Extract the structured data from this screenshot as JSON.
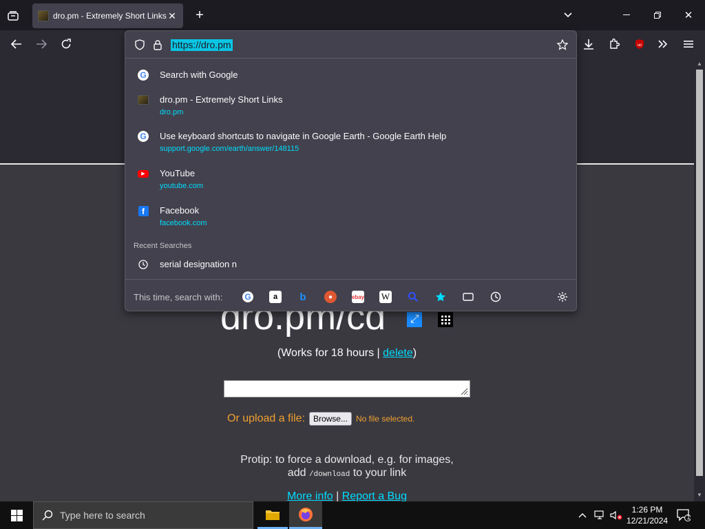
{
  "browser": {
    "tab_title": "dro.pm - Extremely Short Links",
    "url": "https://dro.pm"
  },
  "suggestions": [
    {
      "title": "Search with Google",
      "url": "",
      "icon": "google-icon"
    },
    {
      "title": "dro.pm - Extremely Short Links",
      "url": "dro.pm",
      "icon": "site-favicon"
    },
    {
      "title": "Use keyboard shortcuts to navigate in Google Earth - Google Earth Help",
      "url": "support.google.com/earth/answer/148115",
      "icon": "google-icon"
    },
    {
      "title": "YouTube",
      "url": "youtube.com",
      "icon": "youtube-icon"
    },
    {
      "title": "Facebook",
      "url": "facebook.com",
      "icon": "facebook-icon"
    }
  ],
  "recent": {
    "label": "Recent Searches",
    "items": [
      "serial designation n"
    ]
  },
  "search_with": {
    "label": "This time, search with:"
  },
  "page": {
    "short_url": "dro.pm/cd",
    "works_prefix": "(Works for 18 hours | ",
    "delete": "delete",
    "works_suffix": ")",
    "upload_label": "Or upload a file:",
    "browse": "Browse...",
    "no_file": "No file selected.",
    "protip_line1": "Protip: to force a download, e.g. for images,",
    "protip_add": "add",
    "protip_code": "/download",
    "protip_end": "to your link",
    "more_info": "More info",
    "sep": "|",
    "report_bug": "Report a Bug"
  },
  "taskbar": {
    "search_placeholder": "Type here to search",
    "time": "1:26 PM",
    "date": "12/21/2024",
    "notif_count": "1"
  }
}
